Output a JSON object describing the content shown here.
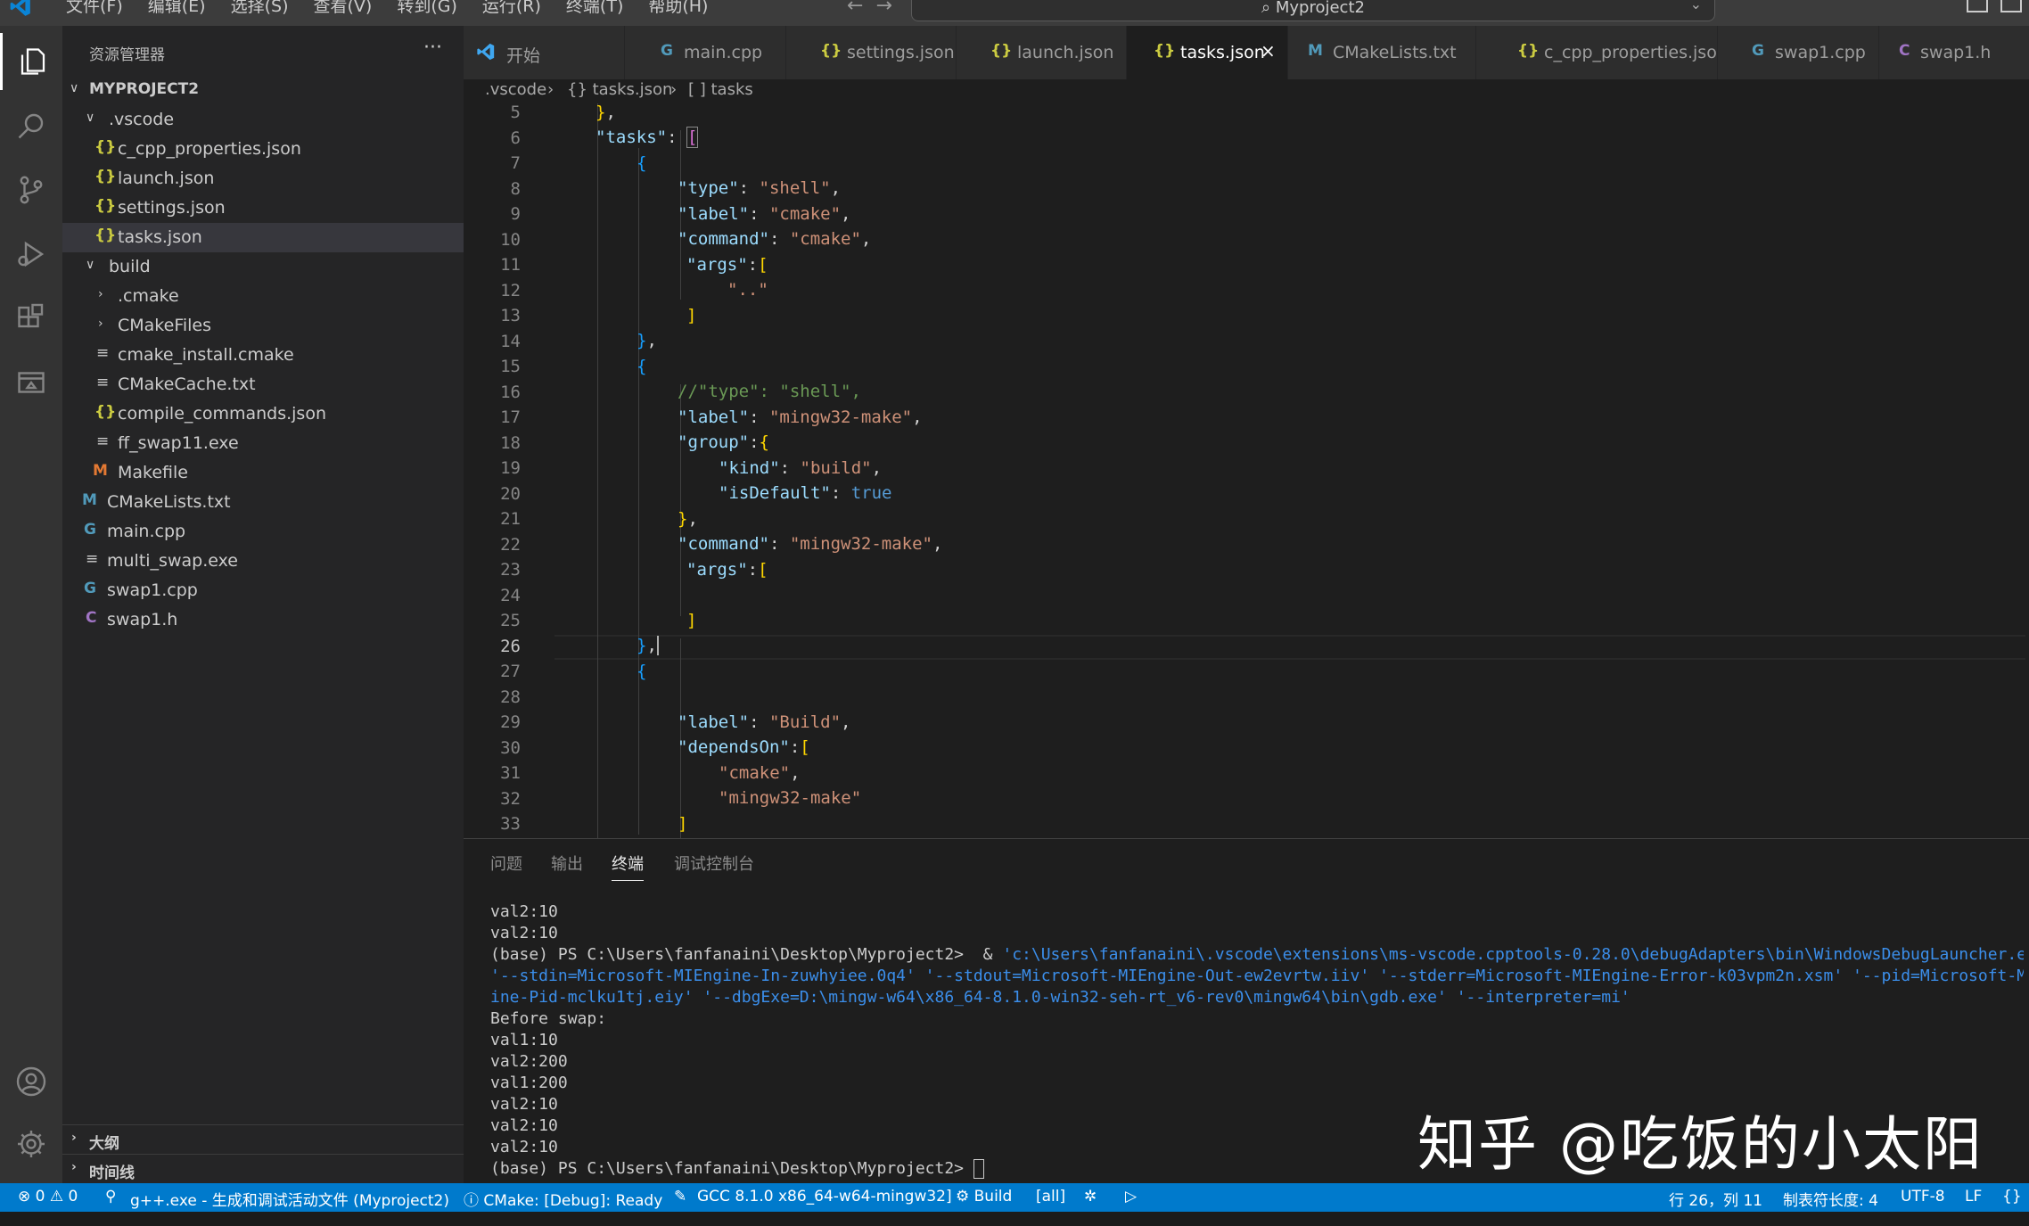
{
  "menu": [
    "文件(F)",
    "编辑(E)",
    "选择(S)",
    "查看(V)",
    "转到(G)",
    "运行(R)",
    "终端(T)",
    "帮助(H)"
  ],
  "command_center": {
    "text": "Myproject2"
  },
  "activity_bar": [
    "explorer-icon",
    "search-icon",
    "source-control-icon",
    "run-debug-icon",
    "extensions-icon",
    "remote-explorer-icon",
    "account-icon",
    "settings-gear-icon"
  ],
  "sidebar": {
    "title": "资源管理器",
    "more": "···",
    "project": "MYPROJECT2",
    "items": [
      {
        "label": ".vscode",
        "icon": "folder-open"
      },
      {
        "label": "c_cpp_properties.json",
        "icon": "{}"
      },
      {
        "label": "launch.json",
        "icon": "{}"
      },
      {
        "label": "settings.json",
        "icon": "{}"
      },
      {
        "label": "tasks.json",
        "icon": "{}",
        "selected": true
      },
      {
        "label": "build",
        "icon": "folder-open"
      },
      {
        "label": ".cmake",
        "icon": "folder"
      },
      {
        "label": "CMakeFiles",
        "icon": "folder"
      },
      {
        "label": "cmake_install.cmake",
        "icon": "≡"
      },
      {
        "label": "CMakeCache.txt",
        "icon": "≡"
      },
      {
        "label": "compile_commands.json",
        "icon": "{}"
      },
      {
        "label": "ff_swap11.exe",
        "icon": "≡"
      },
      {
        "label": "Makefile",
        "icon": "M"
      },
      {
        "label": "CMakeLists.txt",
        "icon": "M"
      },
      {
        "label": "main.cpp",
        "icon": "G"
      },
      {
        "label": "multi_swap.exe",
        "icon": "≡"
      },
      {
        "label": "swap1.cpp",
        "icon": "G"
      },
      {
        "label": "swap1.h",
        "icon": "C"
      }
    ],
    "outline": "大纲",
    "timeline": "时间线"
  },
  "tabs": [
    {
      "label": "开始",
      "icon": "vscode"
    },
    {
      "label": "main.cpp",
      "icon": "G"
    },
    {
      "label": "settings.json",
      "icon": "{}"
    },
    {
      "label": "launch.json",
      "icon": "{}"
    },
    {
      "label": "tasks.json",
      "icon": "{}",
      "active": true
    },
    {
      "label": "CMakeLists.txt",
      "icon": "M"
    },
    {
      "label": "c_cpp_properties.json",
      "icon": "{}"
    },
    {
      "label": "swap1.cpp",
      "icon": "G"
    },
    {
      "label": "swap1.h",
      "icon": "C"
    }
  ],
  "tab_close": "×",
  "breadcrumb": [
    ".vscode",
    "{} tasks.json",
    "[ ] tasks"
  ],
  "editor": {
    "current_line": 26,
    "lines": [
      {
        "n": "5"
      },
      {
        "n": "6"
      },
      {
        "n": "7"
      },
      {
        "n": "8"
      },
      {
        "n": "9"
      },
      {
        "n": "10"
      },
      {
        "n": "11"
      },
      {
        "n": "12"
      },
      {
        "n": "13"
      },
      {
        "n": "14"
      },
      {
        "n": "15"
      },
      {
        "n": "16"
      },
      {
        "n": "17"
      },
      {
        "n": "18"
      },
      {
        "n": "19"
      },
      {
        "n": "20"
      },
      {
        "n": "21"
      },
      {
        "n": "22"
      },
      {
        "n": "23"
      },
      {
        "n": "24"
      },
      {
        "n": "25"
      },
      {
        "n": "26"
      },
      {
        "n": "27"
      },
      {
        "n": "28"
      },
      {
        "n": "29"
      },
      {
        "n": "30"
      },
      {
        "n": "31"
      },
      {
        "n": "32"
      },
      {
        "n": "33"
      }
    ]
  },
  "panel": {
    "tabs": [
      "问题",
      "输出",
      "终端",
      "调试控制台"
    ],
    "active_tab": "终端",
    "terminal_lines": [
      "val2:10",
      "val2:10",
      "(base) PS C:\\Users\\fanfanaini\\Desktop\\Myproject2>  & 'c:\\Users\\fanfanaini\\.vscode\\extensions\\ms-vscode.cpptools-0.28.0\\debugAdapters\\bin\\WindowsDebugLauncher.exe'",
      "'--stdin=Microsoft-MIEngine-In-zuwhyiee.0q4' '--stdout=Microsoft-MIEngine-Out-ew2evrtw.iiv' '--stderr=Microsoft-MIEngine-Error-k03vpm2n.xsm' '--pid=Microsoft-MIEngine-",
      "ine-Pid-mclku1tj.eiy' '--dbgExe=D:\\mingw-w64\\x86_64-8.1.0-win32-seh-rt_v6-rev0\\mingw64\\bin\\gdb.exe' '--interpreter=mi'",
      "Before swap:",
      "val1:10",
      "val2:200",
      "val1:200",
      "val2:10",
      "val2:10",
      "val2:10",
      "(base) PS C:\\Users\\fanfanaini\\Desktop\\Myproject2> "
    ]
  },
  "watermark": "知乎 @吃饭的小太阳",
  "statusbar": {
    "problems": "⊗ 0 ⚠ 0",
    "task": "g++.exe - 生成和调试活动文件 (Myproject2)",
    "cmake": "ⓘ CMake: [Debug]: Ready",
    "kit": "GCC 8.1.0 x86_64-w64-mingw32]",
    "build": "⚙ Build",
    "target": "[all]",
    "position": "行 26，列 11",
    "tabsize": "制表符长度: 4",
    "encoding": "UTF-8",
    "eol": "LF",
    "language": "{}"
  }
}
